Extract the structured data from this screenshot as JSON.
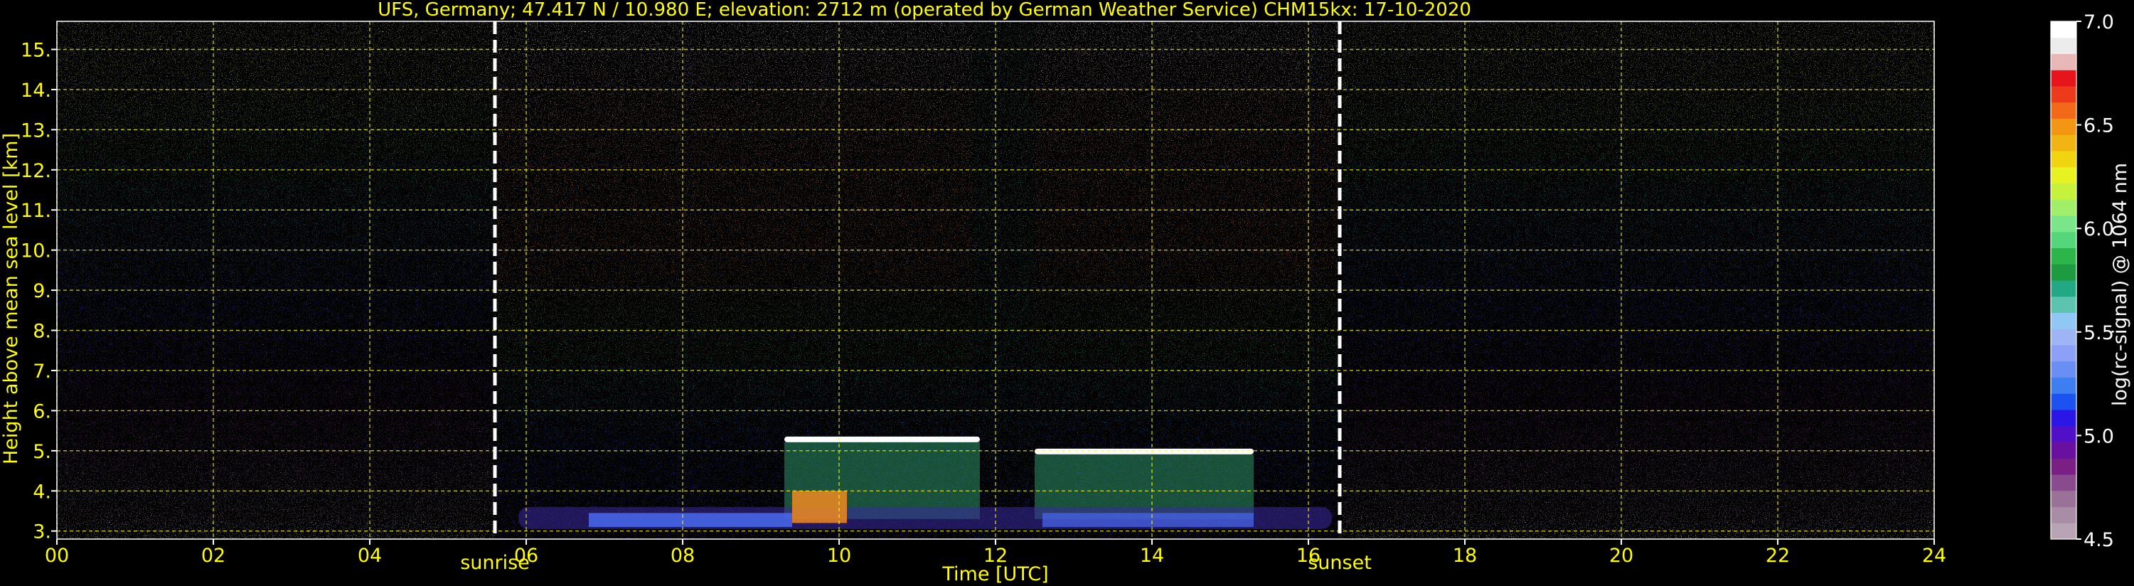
{
  "chart_data": {
    "type": "heatmap",
    "title": "UFS, Germany; 47.417 N / 10.980 E; elevation: 2712 m  (operated by German Weather Service)    CHM15kx: 17-10-2020",
    "xlabel": "Time [UTC]",
    "ylabel": "Height above mean sea level [km]",
    "xlim": [
      0,
      24
    ],
    "ylim": [
      2.8,
      15.7
    ],
    "x_ticks": [
      0,
      2,
      4,
      6,
      8,
      10,
      12,
      14,
      16,
      18,
      20,
      22,
      24
    ],
    "x_tick_labels": [
      "00",
      "02",
      "04",
      "06",
      "08",
      "10",
      "12",
      "14",
      "16",
      "18",
      "20",
      "22",
      "24"
    ],
    "y_ticks": [
      3,
      4,
      5,
      6,
      7,
      8,
      9,
      10,
      11,
      12,
      13,
      14,
      15
    ],
    "y_tick_labels": [
      "3.",
      "4.",
      "5.",
      "6.",
      "7.",
      "8.",
      "9.",
      "10.",
      "11.",
      "12.",
      "13.",
      "14.",
      "15."
    ],
    "grid": true,
    "annotations": [
      {
        "x": 5.6,
        "text": "sunrise"
      },
      {
        "x": 16.4,
        "text": "sunset"
      }
    ],
    "colorbar": {
      "label": "log(rc-signal) @ 1064 nm",
      "range": [
        4.5,
        7.0
      ],
      "tick_values": [
        4.5,
        5.0,
        5.5,
        6.0,
        6.5,
        7.0
      ],
      "tick_labels": [
        "4.5",
        "5.0",
        "5.5",
        "6.0",
        "6.5",
        "7.0"
      ],
      "colors": [
        "#b8a3b5",
        "#a98da7",
        "#9a7298",
        "#8a4a8e",
        "#7a1f84",
        "#6a10a0",
        "#5010c8",
        "#2a16e6",
        "#1b52f0",
        "#3d7ff0",
        "#6a8ff4",
        "#8ca0f6",
        "#9fb4f4",
        "#8fc8f4",
        "#5cc4ae",
        "#22a884",
        "#1e9a40",
        "#2cb64a",
        "#56d67a",
        "#7ae68a",
        "#a0ee6a",
        "#c6f23c",
        "#e8f220",
        "#f0d410",
        "#f2b412",
        "#f29614",
        "#f26a18",
        "#ee3a1c",
        "#e8141c",
        "#e8b8b8",
        "#ececec",
        "#ffffff"
      ]
    },
    "features": [
      {
        "name": "cloud layer",
        "x_range": [
          9.3,
          11.8
        ],
        "height_km": 5.3
      },
      {
        "name": "cloud layer",
        "x_range": [
          12.5,
          15.3
        ],
        "height_km": 5.0
      },
      {
        "name": "boundary layer",
        "x_range": [
          5.9,
          16.3
        ],
        "height_km": 3.6
      }
    ]
  }
}
